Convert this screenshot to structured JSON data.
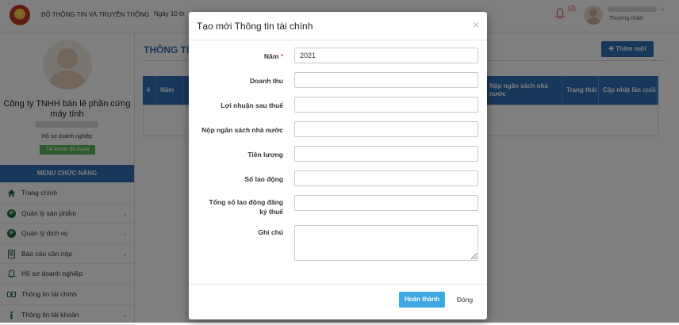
{
  "header": {
    "org_name": "BỘ THÔNG TIN VÀ TRUYỀN THÔNG",
    "date_text": "Ngày 10 th",
    "notification_count": "(2)",
    "user_role": "Thương nhân"
  },
  "sidebar": {
    "company_name": "Công ty TNHH bán lẻ phần cứng máy tính",
    "profile_label": "Hồ sơ doanh nghiệp",
    "account_status": "Tài khoản đã duyệt",
    "menu_title": "MENU CHỨC NĂNG",
    "items": [
      {
        "label": "Trang chính",
        "icon": "home-icon"
      },
      {
        "label": "Quản lý sản phẩm",
        "icon": "product-icon"
      },
      {
        "label": "Quản lý dịch vụ",
        "icon": "service-icon"
      },
      {
        "label": "Báo cáo cần nộp",
        "icon": "report-icon"
      },
      {
        "label": "Hồ sơ doanh nghiệp",
        "icon": "bell-icon"
      },
      {
        "label": "Thông tin tài chính",
        "icon": "money-icon"
      },
      {
        "label": "Thông tin tài khoản",
        "icon": "info-icon"
      }
    ]
  },
  "main": {
    "title": "THÔNG TIN",
    "add_button": "Thêm mới",
    "columns": [
      "#",
      "Năm",
      "Nộp ngân sách nhà nước",
      "Trạng thái",
      "Cập nhật lần cuối"
    ]
  },
  "modal": {
    "title": "Tạo mới Thông tin tài chính",
    "close_symbol": "×",
    "fields": {
      "year": {
        "label": "Năm",
        "required": "*",
        "value": "2021"
      },
      "revenue": {
        "label": "Doanh thu",
        "value": ""
      },
      "profit": {
        "label": "Lợi nhuận sau thuế",
        "value": ""
      },
      "tax": {
        "label": "Nộp ngân sách nhà nước",
        "value": ""
      },
      "salary": {
        "label": "Tiền lương",
        "value": ""
      },
      "workers": {
        "label": "Số lao động",
        "value": ""
      },
      "registered_workers": {
        "label": "Tổng số lao động đăng ký thuế",
        "value": ""
      },
      "note": {
        "label": "Ghi chú",
        "value": ""
      }
    },
    "submit_label": "Hoàn thành",
    "close_label": "Đóng"
  },
  "colors": {
    "primary": "#2f6fb6",
    "submit": "#3ea6e0",
    "approved": "#5cb85c",
    "required": "#d9534f"
  }
}
